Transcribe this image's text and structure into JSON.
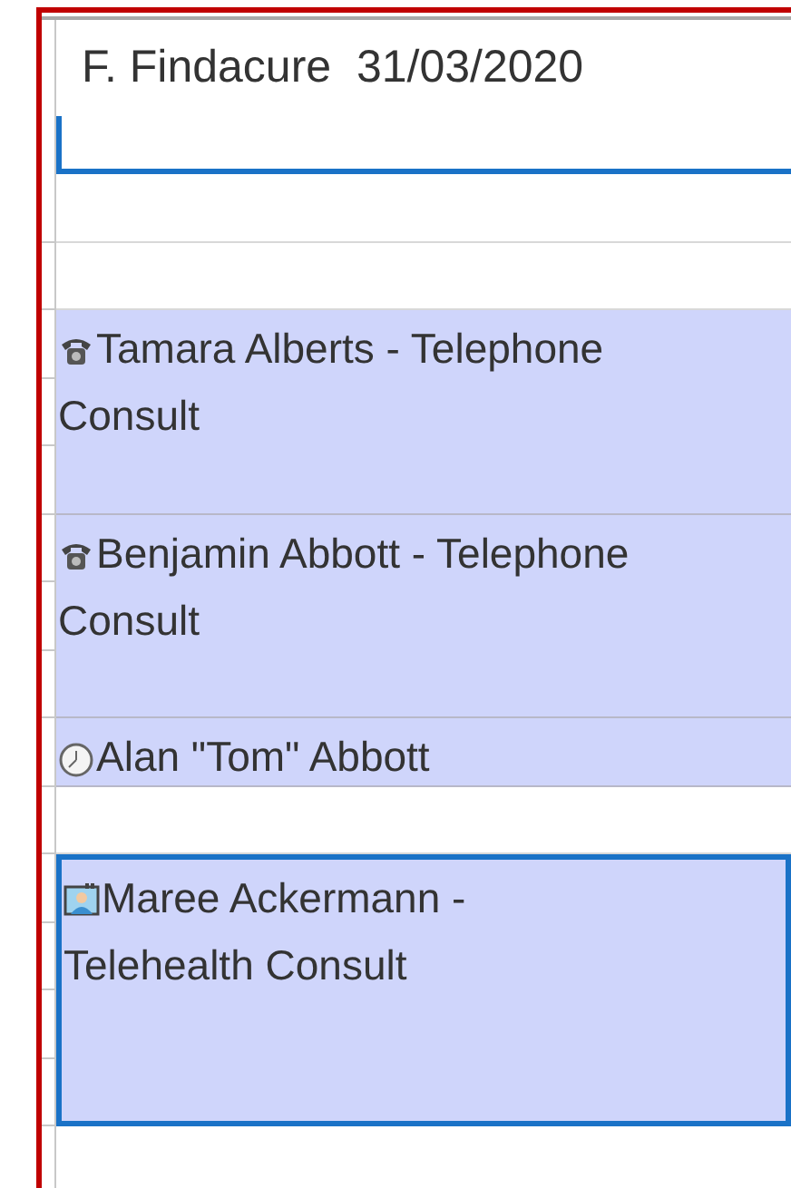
{
  "column_header": {
    "title": "F. Findacure  31/03/2020"
  },
  "slots": [
    {
      "kind": "empty"
    },
    {
      "kind": "empty"
    },
    {
      "kind": "phone",
      "lines": [
        "Tamara Alberts - Telephone",
        "Consult"
      ],
      "selected": false
    },
    {
      "kind": "continued"
    },
    {
      "kind": "continued"
    },
    {
      "kind": "phone",
      "lines": [
        "Benjamin Abbott - Telephone",
        "Consult"
      ],
      "selected": false
    },
    {
      "kind": "continued"
    },
    {
      "kind": "continued"
    },
    {
      "kind": "clock",
      "lines": [
        "Alan \"Tom\" Abbott"
      ],
      "selected": false
    },
    {
      "kind": "empty"
    },
    {
      "kind": "video",
      "lines": [
        "Maree Ackermann -",
        "Telehealth Consult"
      ],
      "selected": true
    },
    {
      "kind": "continued"
    },
    {
      "kind": "continued"
    },
    {
      "kind": "continued"
    },
    {
      "kind": "empty"
    }
  ]
}
